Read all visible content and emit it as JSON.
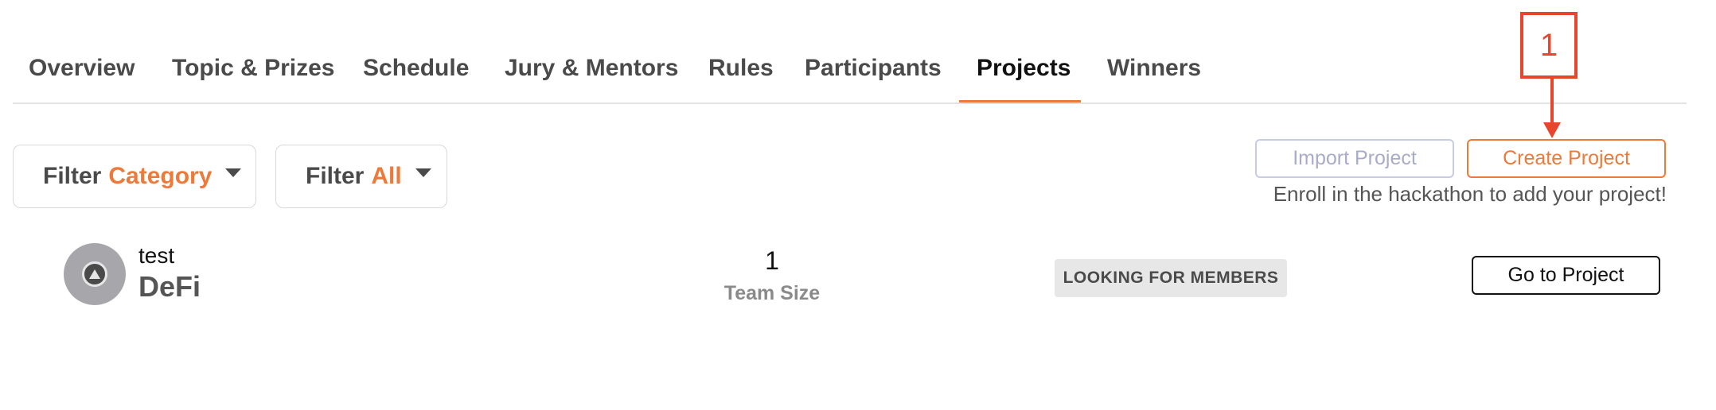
{
  "tabs": [
    {
      "label": "Overview"
    },
    {
      "label": "Topic & Prizes"
    },
    {
      "label": "Schedule"
    },
    {
      "label": "Jury & Mentors"
    },
    {
      "label": "Rules"
    },
    {
      "label": "Participants"
    },
    {
      "label": "Projects"
    },
    {
      "label": "Winners"
    }
  ],
  "active_tab": "Projects",
  "filters": {
    "category": {
      "prefix": "Filter",
      "value": "Category"
    },
    "all": {
      "prefix": "Filter",
      "value": "All"
    }
  },
  "actions": {
    "import_label": "Import Project",
    "create_label": "Create Project",
    "enroll_note": "Enroll in the hackathon to add your project!"
  },
  "annotation": {
    "number": "1",
    "color": "#e5462c"
  },
  "project": {
    "name": "test",
    "category": "DeFi",
    "team_size": "1",
    "team_size_label": "Team Size",
    "status": "LOOKING FOR MEMBERS",
    "goto_label": "Go to Project"
  },
  "colors": {
    "accent": "#ec7a3b",
    "import_border": "#c9cbe6"
  }
}
